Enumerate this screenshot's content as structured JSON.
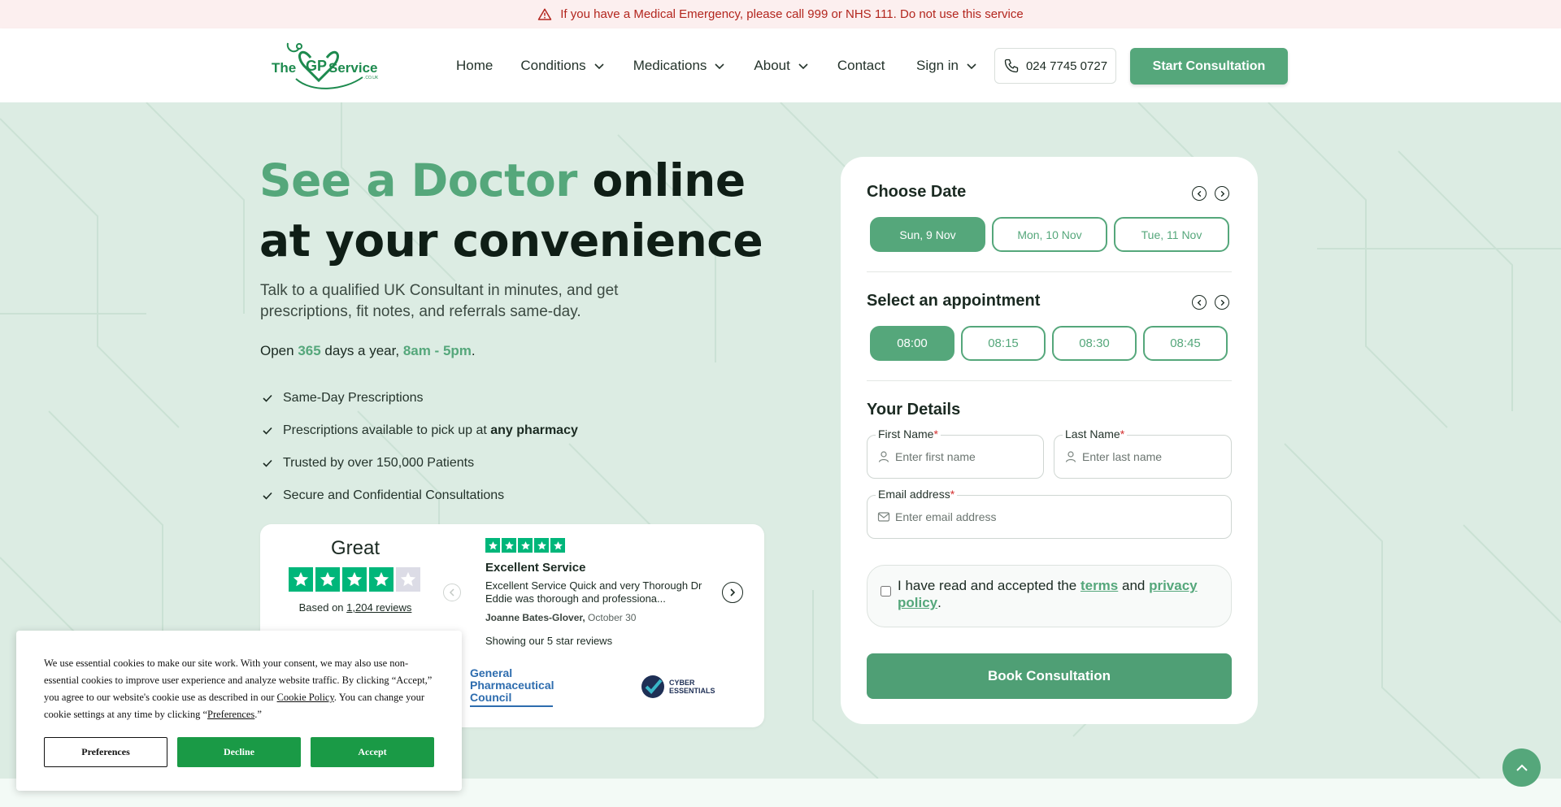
{
  "alert": {
    "text": "If you have a Medical Emergency, please call 999 or NHS 111. Do not use this service"
  },
  "header": {
    "logo_text": "The GP Service",
    "nav": [
      {
        "label": "Home",
        "dropdown": false
      },
      {
        "label": "Conditions",
        "dropdown": true
      },
      {
        "label": "Medications",
        "dropdown": true
      },
      {
        "label": "About",
        "dropdown": true
      },
      {
        "label": "Contact",
        "dropdown": false
      }
    ],
    "signin_label": "Sign in",
    "phone": "024 7745 0727",
    "cta_label": "Start Consultation"
  },
  "hero": {
    "title_accent": "See a Doctor",
    "title_rest": " online at your convenience",
    "subtitle": "Talk to a qualified UK Consultant in minutes, and get prescriptions, fit notes, and referrals same-day.",
    "open": {
      "prefix": "Open ",
      "days": "365",
      "middle": " days a year, ",
      "hours": "8am - 5pm",
      "suffix": "."
    },
    "features": {
      "f1": "Same-Day Prescriptions",
      "f2_prefix": "Prescriptions available to pick up at ",
      "f2_bold": "any pharmacy",
      "f3": "Trusted by over 150,000 Patients",
      "f4": "Secure and Confidential Consultations"
    }
  },
  "reviews": {
    "rating_word": "Great",
    "rating_stars": 4,
    "based_prefix": "Based on ",
    "based_link": "1,204 reviews",
    "review_title": "Excellent Service",
    "review_text": "Excellent Service Quick and very Thorough Dr Eddie was thorough and professiona...",
    "review_author": "Joanne Bates-Glover,",
    "review_date": " October 30",
    "showing": "Showing our 5 star reviews",
    "gphc_line1": "General",
    "gphc_line2": "Pharmaceutical",
    "gphc_line3": "Council",
    "cyber_line1": "CYBER",
    "cyber_line2": "ESSENTIALS"
  },
  "booking": {
    "date_title": "Choose Date",
    "dates": [
      "Sun, 9 Nov",
      "Mon, 10 Nov",
      "Tue, 11 Nov"
    ],
    "appt_title": "Select an appointment",
    "times": [
      "08:00",
      "08:15",
      "08:30",
      "08:45"
    ],
    "details_title": "Your Details",
    "first_name_label": "First Name",
    "first_name_placeholder": "Enter first name",
    "last_name_label": "Last Name",
    "last_name_placeholder": "Enter last name",
    "email_label": "Email address",
    "email_placeholder": "Enter email address",
    "required_mark": "*",
    "consent_prefix": "I have read and accepted the ",
    "terms_link": "terms",
    "consent_and": " and ",
    "privacy_link": "privacy policy",
    "consent_suffix": ".",
    "book_label": "Book Consultation"
  },
  "cookie": {
    "text_1": "We use essential cookies to make our site work. With your consent, we may also use non-essential cookies to improve user experience and analyze website traffic. By clicking “Accept,” you agree to our website's cookie use as described in our ",
    "policy_link": "Cookie Policy",
    "text_2": ". You can change your cookie settings at any time by clicking “",
    "pref_link": "Preferences",
    "text_3": ".”",
    "preferences_label": "Preferences",
    "decline_label": "Decline",
    "accept_label": "Accept"
  },
  "colors": {
    "brand_green": "#55a77b",
    "hero_bg": "#dcece3",
    "alert_red": "#b3261e",
    "trustpilot_green": "#00b67a",
    "cookie_green": "#1a9a46"
  },
  "icons": [
    "warning-icon",
    "chevron-down-icon",
    "phone-icon",
    "check-icon",
    "star-icon",
    "chevron-left-icon",
    "chevron-right-icon",
    "user-icon",
    "mail-icon",
    "arrow-up-icon"
  ]
}
